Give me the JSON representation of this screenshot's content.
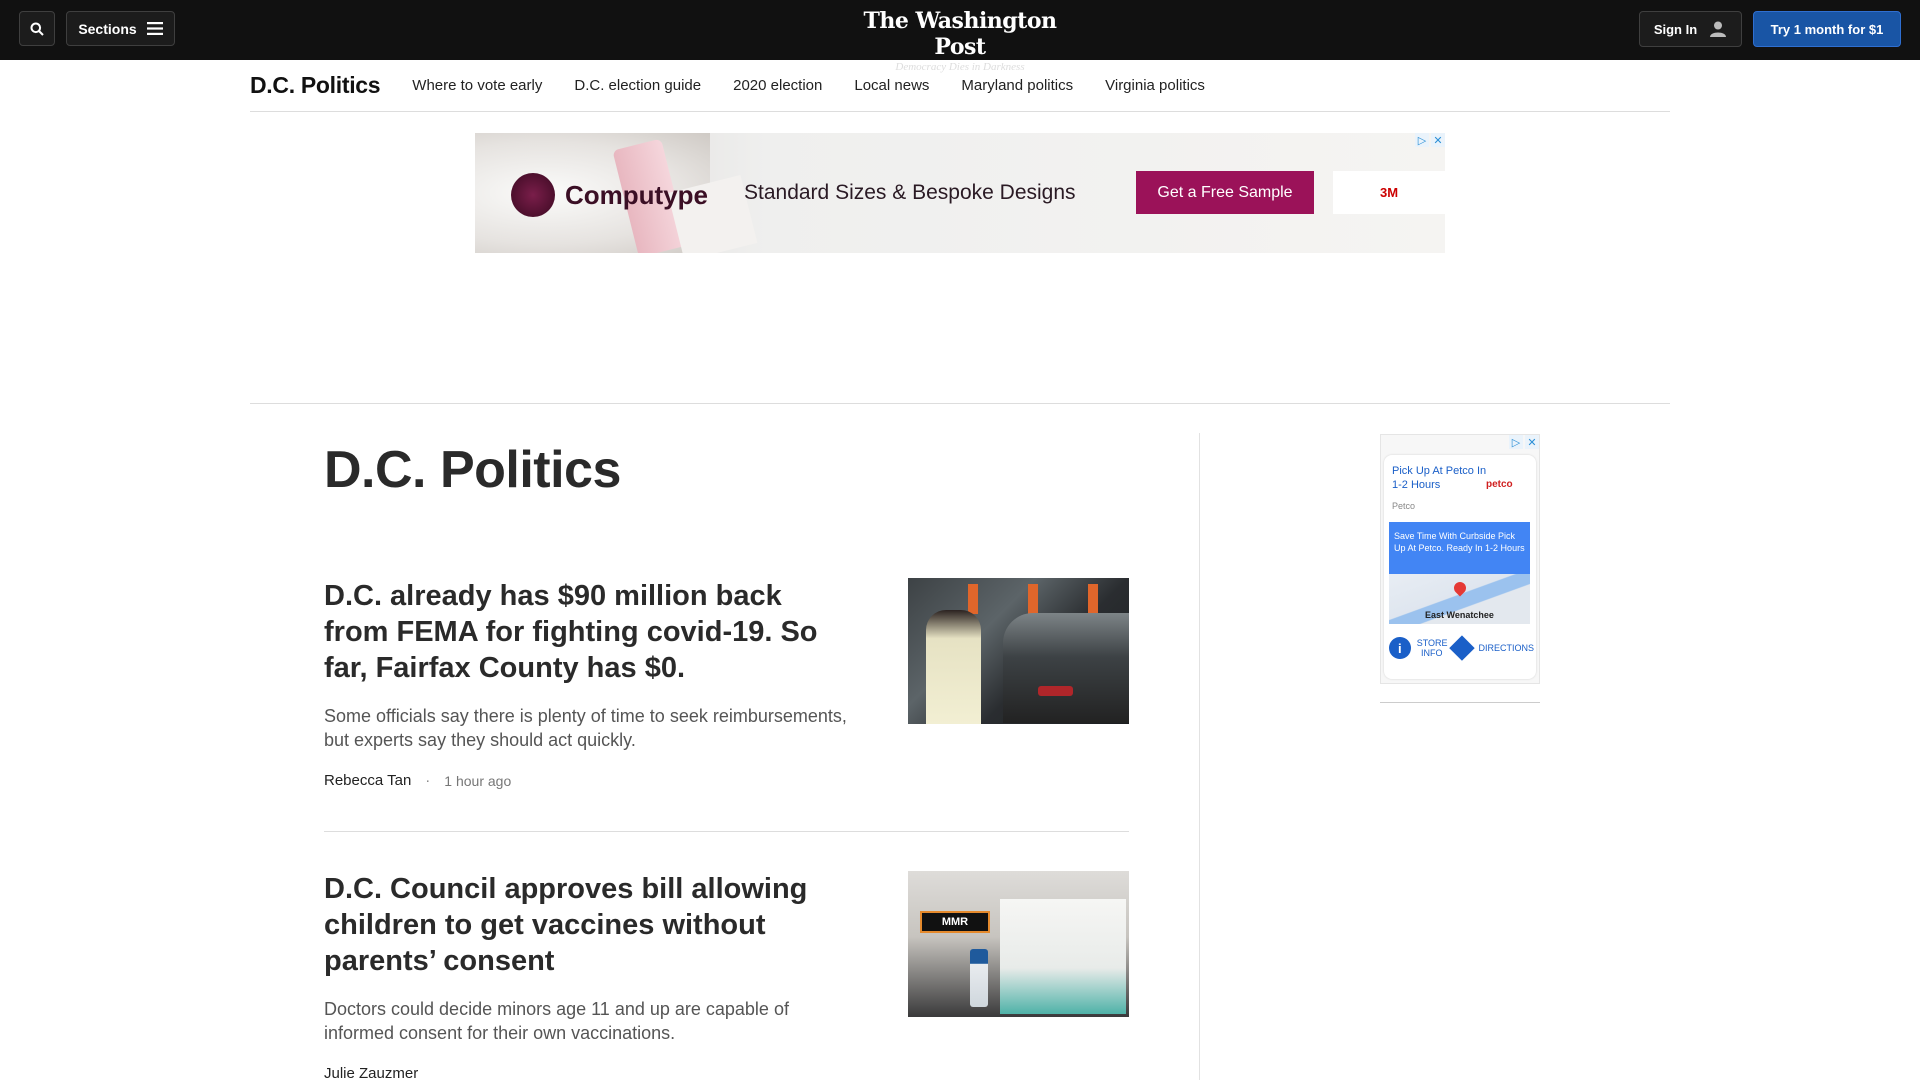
{
  "masthead": {
    "sections_label": "Sections",
    "logo_name": "The Washington Post",
    "logo_tagline": "Democracy Dies in Darkness",
    "signin_label": "Sign In",
    "subscribe_label": "Try 1 month for $1"
  },
  "section_nav": {
    "title": "D.C. Politics",
    "links": [
      "Where to vote early",
      "D.C. election guide",
      "2020 election",
      "Local news",
      "Maryland politics",
      "Virginia politics"
    ]
  },
  "banner_ad": {
    "brand": "Computype",
    "headline": "Standard Sizes & Bespoke Designs",
    "cta": "Get a Free Sample",
    "partner": "3M"
  },
  "page": {
    "title": "D.C. Politics"
  },
  "stories": [
    {
      "headline": "D.C. already has $90 million back from FEMA for fighting covid-19. So far, Fairfax County has $0.",
      "dek": "Some officials say there is plenty of time to seek reimbursements, but experts say they should act quickly.",
      "author": "Rebecca Tan",
      "time": "1 hour ago"
    },
    {
      "headline": "D.C. Council approves bill allowing children to get vaccines without parents’ consent",
      "dek": "Doctors could decide minors age 11 and up are capable of informed consent for their own vaccinations.",
      "author": "Julie Zauzmer",
      "image_label": "MMR"
    }
  ],
  "rail_ad": {
    "title": "Pick Up At Petco In 1-2 Hours",
    "brand": "petco",
    "advertiser": "Petco",
    "body": "Save Time With Curbside Pick Up At Petco. Ready In 1-2 Hours",
    "map_label": "East Wenatchee",
    "store_info": "STORE INFO",
    "directions": "DIRECTIONS"
  }
}
